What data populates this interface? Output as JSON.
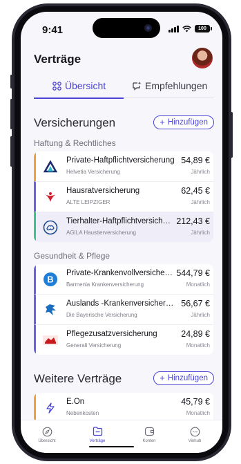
{
  "status": {
    "time": "9:41",
    "battery": "100"
  },
  "page_title": "Verträge",
  "tabs": [
    {
      "label": "Übersicht",
      "active": true
    },
    {
      "label": "Empfehlungen",
      "active": false
    }
  ],
  "insurance": {
    "heading": "Versicherungen",
    "add_label": "Hinzufügen",
    "groups": [
      {
        "label": "Haftung & Rechtliches",
        "items": [
          {
            "name": "Private-Haftpflichtversicherung",
            "insurer": "Helvetia Versicherung",
            "price": "54,89 €",
            "frequency": "Jährlich",
            "accent": "#f0a23a",
            "logo": "helvetia-logo"
          },
          {
            "name": "Hausratversicherung",
            "insurer": "ALTE LEIPZIGER",
            "price": "62,45 €",
            "frequency": "Jährlich",
            "accent": "#6a62e0",
            "logo": "alte-leipziger-logo"
          },
          {
            "name": "Tierhalter-Haftpflichtversicher…",
            "insurer": "AGILA Haustierversicherung",
            "price": "212,43 €",
            "frequency": "Jährlich",
            "accent": "#3cc58a",
            "logo": "agila-logo"
          }
        ]
      },
      {
        "label": "Gesundheit & Pflege",
        "items": [
          {
            "name": "Private-Krankenvollversicheru…",
            "insurer": "Barmenia Krankenversicherung",
            "price": "544,79 €",
            "frequency": "Monatlich",
            "accent": "#6a62e0",
            "logo": "barmenia-logo"
          },
          {
            "name": "Auslands -Krankenversicherung",
            "insurer": "Die Bayerische Versicherung",
            "price": "56,67 €",
            "frequency": "Jährlich",
            "accent": "#6a62e0",
            "logo": "bayerische-logo"
          },
          {
            "name": "Pflegezusatzversicherung",
            "insurer": "Generali Versicherung",
            "price": "24,89 €",
            "frequency": "Monatlich",
            "accent": "#6a62e0",
            "logo": "generali-logo"
          }
        ]
      }
    ]
  },
  "other": {
    "heading": "Weitere Verträge",
    "add_label": "Hinzufügen",
    "items": [
      {
        "name": "E.On",
        "insurer": "Nebenkosten",
        "price": "45,79 €",
        "frequency": "Monatlich",
        "accent": "#f0a23a",
        "logo": "lightning-icon"
      }
    ]
  },
  "bottom_nav": [
    {
      "label": "Übersicht",
      "icon": "compass-icon",
      "active": false
    },
    {
      "label": "Verträge",
      "icon": "folder-icon",
      "active": true
    },
    {
      "label": "Konten",
      "icon": "wallet-icon",
      "active": false
    },
    {
      "label": "Vinhub",
      "icon": "chat-icon",
      "active": false
    }
  ],
  "colors": {
    "accent": "#4a43d6",
    "background": "#f7f6fb"
  }
}
